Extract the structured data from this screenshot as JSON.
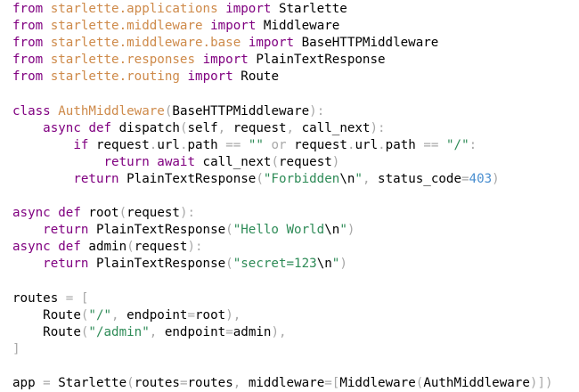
{
  "editor": {
    "language": "python",
    "colors": {
      "background": "#ffffff",
      "keyword": "#800080",
      "module": "#ce8a4a",
      "class_name": "#ce8a4a",
      "string": "#2e8b57",
      "punctuation": "#a8a8a8",
      "number": "#4a8fd0",
      "identifier": "#000000"
    },
    "lines": [
      [
        [
          "kw",
          "from"
        ],
        [
          "n",
          " "
        ],
        [
          "mod",
          "starlette.applications"
        ],
        [
          "n",
          " "
        ],
        [
          "kw",
          "import"
        ],
        [
          "n",
          " Starlette"
        ]
      ],
      [
        [
          "kw",
          "from"
        ],
        [
          "n",
          " "
        ],
        [
          "mod",
          "starlette.middleware"
        ],
        [
          "n",
          " "
        ],
        [
          "kw",
          "import"
        ],
        [
          "n",
          " Middleware"
        ]
      ],
      [
        [
          "kw",
          "from"
        ],
        [
          "n",
          " "
        ],
        [
          "mod",
          "starlette.middleware.base"
        ],
        [
          "n",
          " "
        ],
        [
          "kw",
          "import"
        ],
        [
          "n",
          " BaseHTTPMiddleware"
        ]
      ],
      [
        [
          "kw",
          "from"
        ],
        [
          "n",
          " "
        ],
        [
          "mod",
          "starlette.responses"
        ],
        [
          "n",
          " "
        ],
        [
          "kw",
          "import"
        ],
        [
          "n",
          " PlainTextResponse"
        ]
      ],
      [
        [
          "kw",
          "from"
        ],
        [
          "n",
          " "
        ],
        [
          "mod",
          "starlette.routing"
        ],
        [
          "n",
          " "
        ],
        [
          "kw",
          "import"
        ],
        [
          "n",
          " Route"
        ]
      ],
      [],
      [
        [
          "kw",
          "class"
        ],
        [
          "n",
          " "
        ],
        [
          "cls",
          "AuthMiddleware"
        ],
        [
          "p",
          "("
        ],
        [
          "n",
          "BaseHTTPMiddleware"
        ],
        [
          "p",
          "):"
        ]
      ],
      [
        [
          "n",
          "    "
        ],
        [
          "kw",
          "async"
        ],
        [
          "n",
          " "
        ],
        [
          "kw",
          "def"
        ],
        [
          "n",
          " dispatch"
        ],
        [
          "p",
          "("
        ],
        [
          "n",
          "self"
        ],
        [
          "p",
          ","
        ],
        [
          "n",
          " request"
        ],
        [
          "p",
          ","
        ],
        [
          "n",
          " call_next"
        ],
        [
          "p",
          "):"
        ]
      ],
      [
        [
          "n",
          "        "
        ],
        [
          "kw",
          "if"
        ],
        [
          "n",
          " request"
        ],
        [
          "p",
          "."
        ],
        [
          "n",
          "url"
        ],
        [
          "p",
          "."
        ],
        [
          "n",
          "path"
        ],
        [
          "n",
          " "
        ],
        [
          "p",
          "=="
        ],
        [
          "n",
          " "
        ],
        [
          "str",
          "\"\""
        ],
        [
          "n",
          " "
        ],
        [
          "p",
          "or"
        ],
        [
          "n",
          " request"
        ],
        [
          "p",
          "."
        ],
        [
          "n",
          "url"
        ],
        [
          "p",
          "."
        ],
        [
          "n",
          "path"
        ],
        [
          "n",
          " "
        ],
        [
          "p",
          "=="
        ],
        [
          "n",
          " "
        ],
        [
          "str",
          "\"/\""
        ],
        [
          "p",
          ":"
        ]
      ],
      [
        [
          "n",
          "            "
        ],
        [
          "kw",
          "return"
        ],
        [
          "n",
          " "
        ],
        [
          "kw",
          "await"
        ],
        [
          "n",
          " call_next"
        ],
        [
          "p",
          "("
        ],
        [
          "n",
          "request"
        ],
        [
          "p",
          ")"
        ]
      ],
      [
        [
          "n",
          "        "
        ],
        [
          "kw",
          "return"
        ],
        [
          "n",
          " PlainTextResponse"
        ],
        [
          "p",
          "("
        ],
        [
          "str",
          "\"Forbidden"
        ],
        [
          "esc",
          "\\n"
        ],
        [
          "str",
          "\""
        ],
        [
          "p",
          ","
        ],
        [
          "n",
          " status_code"
        ],
        [
          "p",
          "="
        ],
        [
          "num",
          "403"
        ],
        [
          "p",
          ")"
        ]
      ],
      [],
      [
        [
          "kw",
          "async"
        ],
        [
          "n",
          " "
        ],
        [
          "kw",
          "def"
        ],
        [
          "n",
          " root"
        ],
        [
          "p",
          "("
        ],
        [
          "n",
          "request"
        ],
        [
          "p",
          "):"
        ]
      ],
      [
        [
          "n",
          "    "
        ],
        [
          "kw",
          "return"
        ],
        [
          "n",
          " PlainTextResponse"
        ],
        [
          "p",
          "("
        ],
        [
          "str",
          "\"Hello World"
        ],
        [
          "esc",
          "\\n"
        ],
        [
          "str",
          "\""
        ],
        [
          "p",
          ")"
        ]
      ],
      [
        [
          "kw",
          "async"
        ],
        [
          "n",
          " "
        ],
        [
          "kw",
          "def"
        ],
        [
          "n",
          " admin"
        ],
        [
          "p",
          "("
        ],
        [
          "n",
          "request"
        ],
        [
          "p",
          "):"
        ]
      ],
      [
        [
          "n",
          "    "
        ],
        [
          "kw",
          "return"
        ],
        [
          "n",
          " PlainTextResponse"
        ],
        [
          "p",
          "("
        ],
        [
          "str",
          "\"secret=123"
        ],
        [
          "esc",
          "\\n"
        ],
        [
          "str",
          "\""
        ],
        [
          "p",
          ")"
        ]
      ],
      [],
      [
        [
          "n",
          "routes "
        ],
        [
          "p",
          "="
        ],
        [
          "n",
          " "
        ],
        [
          "p",
          "["
        ]
      ],
      [
        [
          "n",
          "    Route"
        ],
        [
          "p",
          "("
        ],
        [
          "str",
          "\"/\""
        ],
        [
          "p",
          ","
        ],
        [
          "n",
          " endpoint"
        ],
        [
          "p",
          "="
        ],
        [
          "n",
          "root"
        ],
        [
          "p",
          "),"
        ]
      ],
      [
        [
          "n",
          "    Route"
        ],
        [
          "p",
          "("
        ],
        [
          "str",
          "\"/admin\""
        ],
        [
          "p",
          ","
        ],
        [
          "n",
          " endpoint"
        ],
        [
          "p",
          "="
        ],
        [
          "n",
          "admin"
        ],
        [
          "p",
          "),"
        ]
      ],
      [
        [
          "p",
          "]"
        ]
      ],
      [],
      [
        [
          "n",
          "app "
        ],
        [
          "p",
          "="
        ],
        [
          "n",
          " Starlette"
        ],
        [
          "p",
          "("
        ],
        [
          "n",
          "routes"
        ],
        [
          "p",
          "="
        ],
        [
          "n",
          "routes"
        ],
        [
          "p",
          ","
        ],
        [
          "n",
          " middleware"
        ],
        [
          "p",
          "=["
        ],
        [
          "n",
          "Middleware"
        ],
        [
          "p",
          "("
        ],
        [
          "n",
          "AuthMiddleware"
        ],
        [
          "p",
          ")])"
        ]
      ]
    ]
  }
}
